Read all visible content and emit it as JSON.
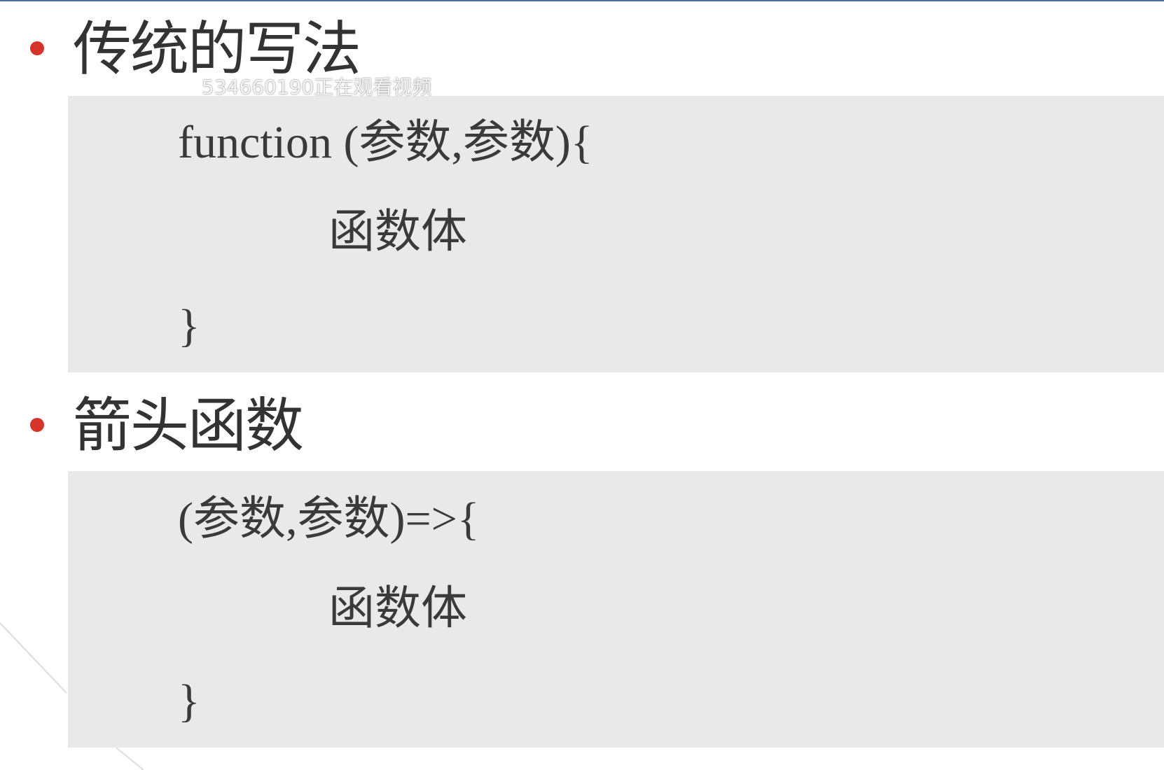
{
  "slide": {
    "sections": [
      {
        "heading": "传统的写法",
        "code": {
          "line1": "function (参数,参数){",
          "body": "函数体",
          "close": "}"
        }
      },
      {
        "heading": "箭头函数",
        "code": {
          "line1": "(参数,参数)=>{",
          "body": "函数体",
          "close": "}"
        }
      }
    ],
    "watermark": "534660190正在观看视频"
  },
  "colors": {
    "bullet": "#d6332b",
    "panel": "#e9e9e9",
    "text": "#333333",
    "top_rule": "#4a6f9c"
  },
  "icons": {
    "bullet": "red-dot-icon"
  }
}
